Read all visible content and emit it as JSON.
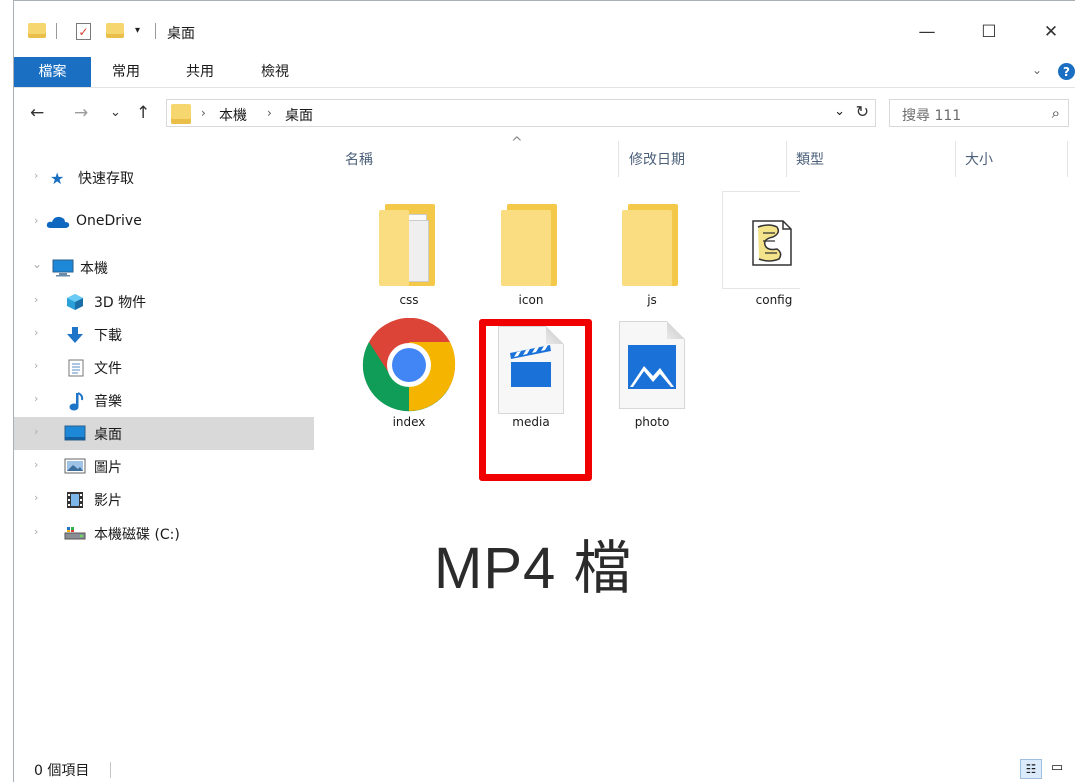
{
  "window": {
    "title": "桌面",
    "minimize": "—",
    "maximize": "☐",
    "close": "✕"
  },
  "ribbon": {
    "tabs": [
      "檔案",
      "常用",
      "共用",
      "檢視"
    ],
    "expand": "⌄",
    "help": "?"
  },
  "address": {
    "back": "←",
    "forward": "→",
    "recent": "⌄",
    "up": "↑",
    "crumbs": [
      "本機",
      "桌面"
    ],
    "crumb_sep": "›",
    "dropdown": "⌄",
    "refresh": "↻",
    "search_placeholder": "搜尋 111",
    "search_icon": "⌕"
  },
  "nav": {
    "items": [
      {
        "label": "快速存取",
        "icon": "star-icon"
      },
      {
        "label": "OneDrive",
        "icon": "cloud-icon"
      },
      {
        "label": "本機",
        "icon": "pc-icon"
      },
      {
        "label": "3D 物件",
        "icon": "cube-icon"
      },
      {
        "label": "下載",
        "icon": "download-icon"
      },
      {
        "label": "文件",
        "icon": "document-icon"
      },
      {
        "label": "音樂",
        "icon": "music-icon"
      },
      {
        "label": "桌面",
        "icon": "desktop-icon"
      },
      {
        "label": "圖片",
        "icon": "picture-icon"
      },
      {
        "label": "影片",
        "icon": "video-icon"
      },
      {
        "label": "本機磁碟 (C:)",
        "icon": "drive-icon"
      }
    ],
    "chevron_collapsed": "›",
    "chevron_expanded": "⌄"
  },
  "columns": {
    "sort_indicator": "^",
    "headers": [
      "名稱",
      "修改日期",
      "類型",
      "大小"
    ]
  },
  "files": [
    {
      "name": "css",
      "icon": "folder-with-files-icon"
    },
    {
      "name": "icon",
      "icon": "folder-icon"
    },
    {
      "name": "js",
      "icon": "folder-icon"
    },
    {
      "name": "config",
      "icon": "script-file-icon"
    },
    {
      "name": "index",
      "icon": "chrome-icon"
    },
    {
      "name": "media",
      "icon": "video-file-icon"
    },
    {
      "name": "photo",
      "icon": "image-file-icon"
    }
  ],
  "annotation": "MP4 檔",
  "highlight_color": "#f00000",
  "status": {
    "count": "0 個項目"
  },
  "colors": {
    "accent": "#1a6fc2",
    "folder": "#f6d66e"
  }
}
